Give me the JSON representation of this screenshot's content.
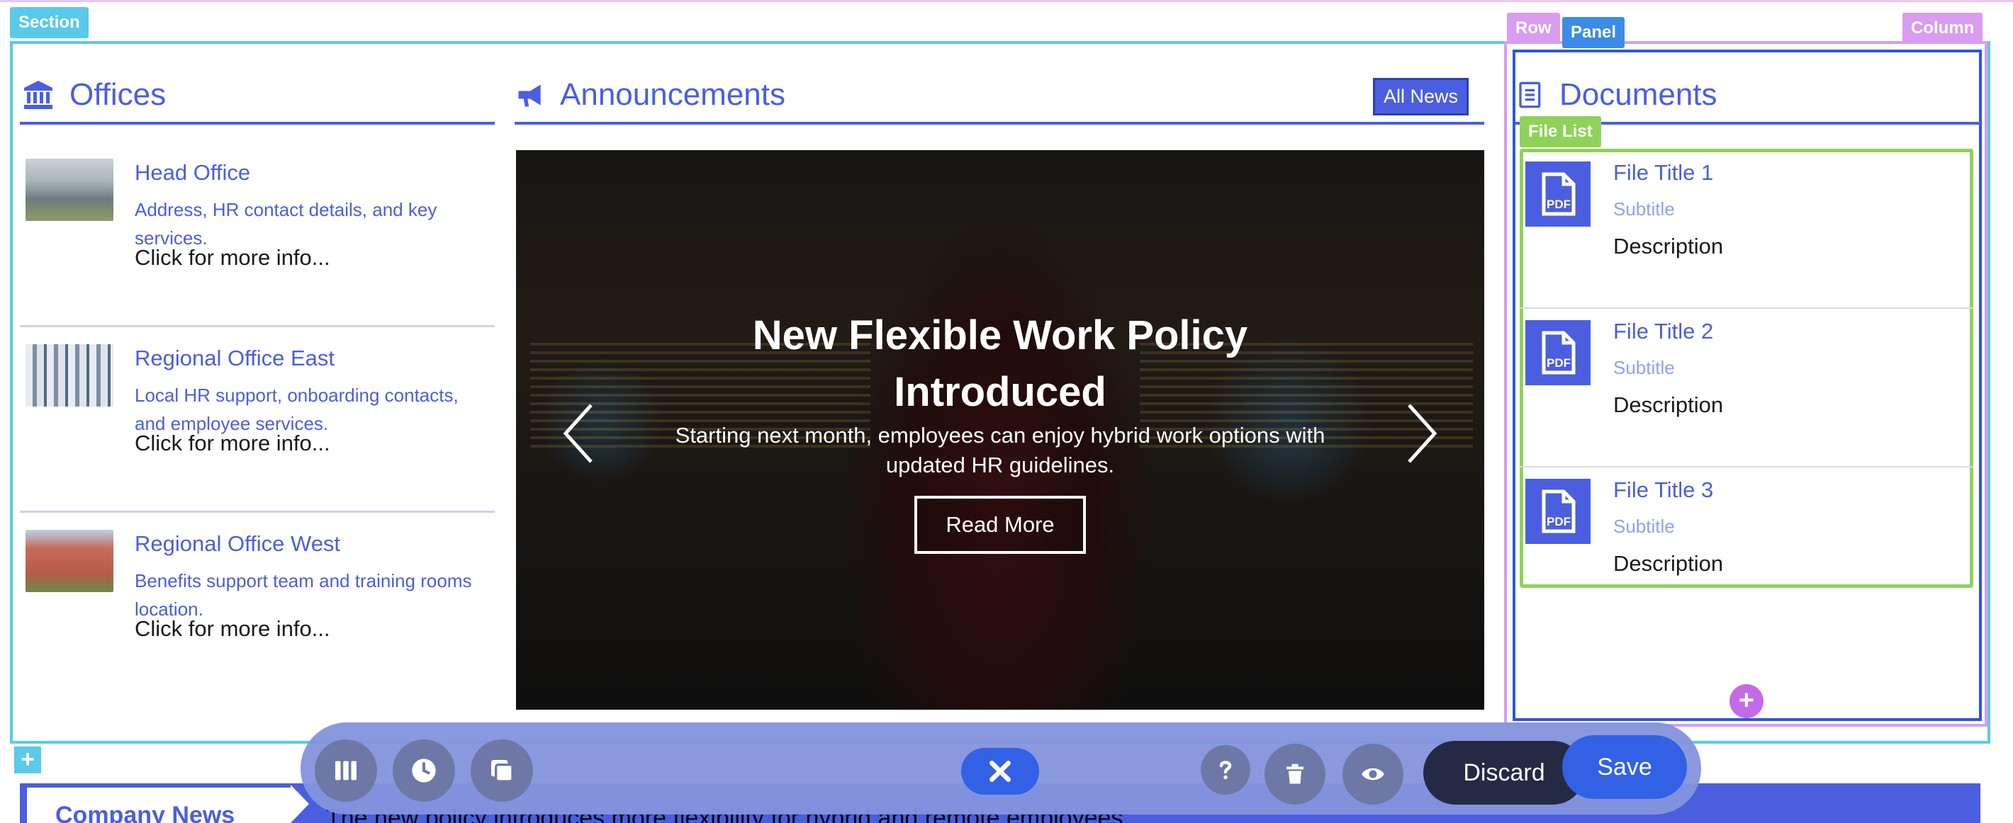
{
  "editor": {
    "tags": {
      "section": "Section",
      "row": "Row",
      "panel": "Panel",
      "column": "Column",
      "file_list": "File List"
    },
    "add_symbol": "+"
  },
  "offices": {
    "title": "Offices",
    "icon": "bank-icon",
    "items": [
      {
        "title": "Head Office",
        "description": "Address, HR contact details, and key services.",
        "more": "Click for more info..."
      },
      {
        "title": "Regional Office East",
        "description": "Local HR support, onboarding contacts, and employee services.",
        "more": "Click for more info..."
      },
      {
        "title": "Regional Office West",
        "description": "Benefits support team and training rooms location.",
        "more": "Click for more info..."
      }
    ]
  },
  "announcements": {
    "title": "Announcements",
    "icon": "megaphone-icon",
    "all_news_label": "All News",
    "slide": {
      "headline": "New Flexible Work Policy Introduced",
      "subtitle": "Starting next month, employees can enjoy hybrid work options with updated HR guidelines.",
      "button_label": "Read More"
    }
  },
  "documents": {
    "title": "Documents",
    "icon": "document-list-icon",
    "files": [
      {
        "title": "File Title 1",
        "subtitle": "Subtitle",
        "description": "Description"
      },
      {
        "title": "File Title 2",
        "subtitle": "Subtitle",
        "description": "Description"
      },
      {
        "title": "File Title 3",
        "subtitle": "Subtitle",
        "description": "Description"
      }
    ]
  },
  "company_news": {
    "label": "Company News",
    "ticker": "The new policy introduces more flexibility for hybrid and remote employees."
  },
  "toolbar": {
    "discard_label": "Discard",
    "save_label": "Save"
  },
  "colors": {
    "accent": "#4b5ee0",
    "section_outline": "#5ac9ea",
    "row_outline": "#d99cf0",
    "panel_outline": "#2e58d6",
    "file_list_outline": "#8fd25a",
    "toolbar_bg": "#8494dc",
    "save_button": "#3261e6",
    "discard_button": "#242a44"
  }
}
